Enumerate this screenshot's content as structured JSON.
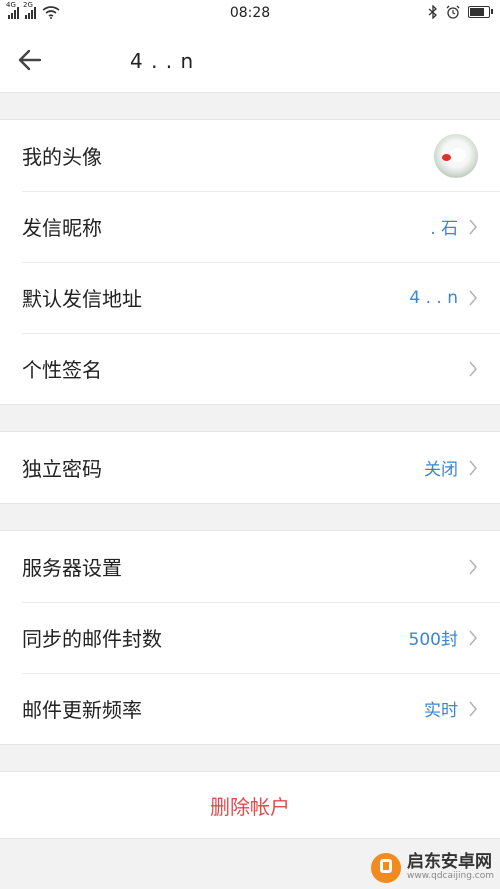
{
  "status_bar": {
    "network_1": "4G",
    "network_2": "2G",
    "time": "08:28",
    "battery_level": 0.85
  },
  "header": {
    "title": "4          .  .     n"
  },
  "sections": {
    "profile": [
      {
        "label": "我的头像",
        "type": "avatar"
      },
      {
        "label": "发信昵称",
        "value": ".      石"
      },
      {
        "label": "默认发信地址",
        "value": "4              .   .       n"
      },
      {
        "label": "个性签名",
        "value": ""
      }
    ],
    "security": [
      {
        "label": "独立密码",
        "value": "关闭"
      }
    ],
    "server": [
      {
        "label": "服务器设置",
        "value": ""
      },
      {
        "label": "同步的邮件封数",
        "value": "500封"
      },
      {
        "label": "邮件更新频率",
        "value": "实时"
      }
    ]
  },
  "delete_label": "删除帐户",
  "watermark": {
    "main": "启东安卓网",
    "sub": "www.qdcaijing.com"
  },
  "colors": {
    "accent": "#3a86d1",
    "danger": "#e24b4b",
    "background": "#f2f2f2"
  }
}
